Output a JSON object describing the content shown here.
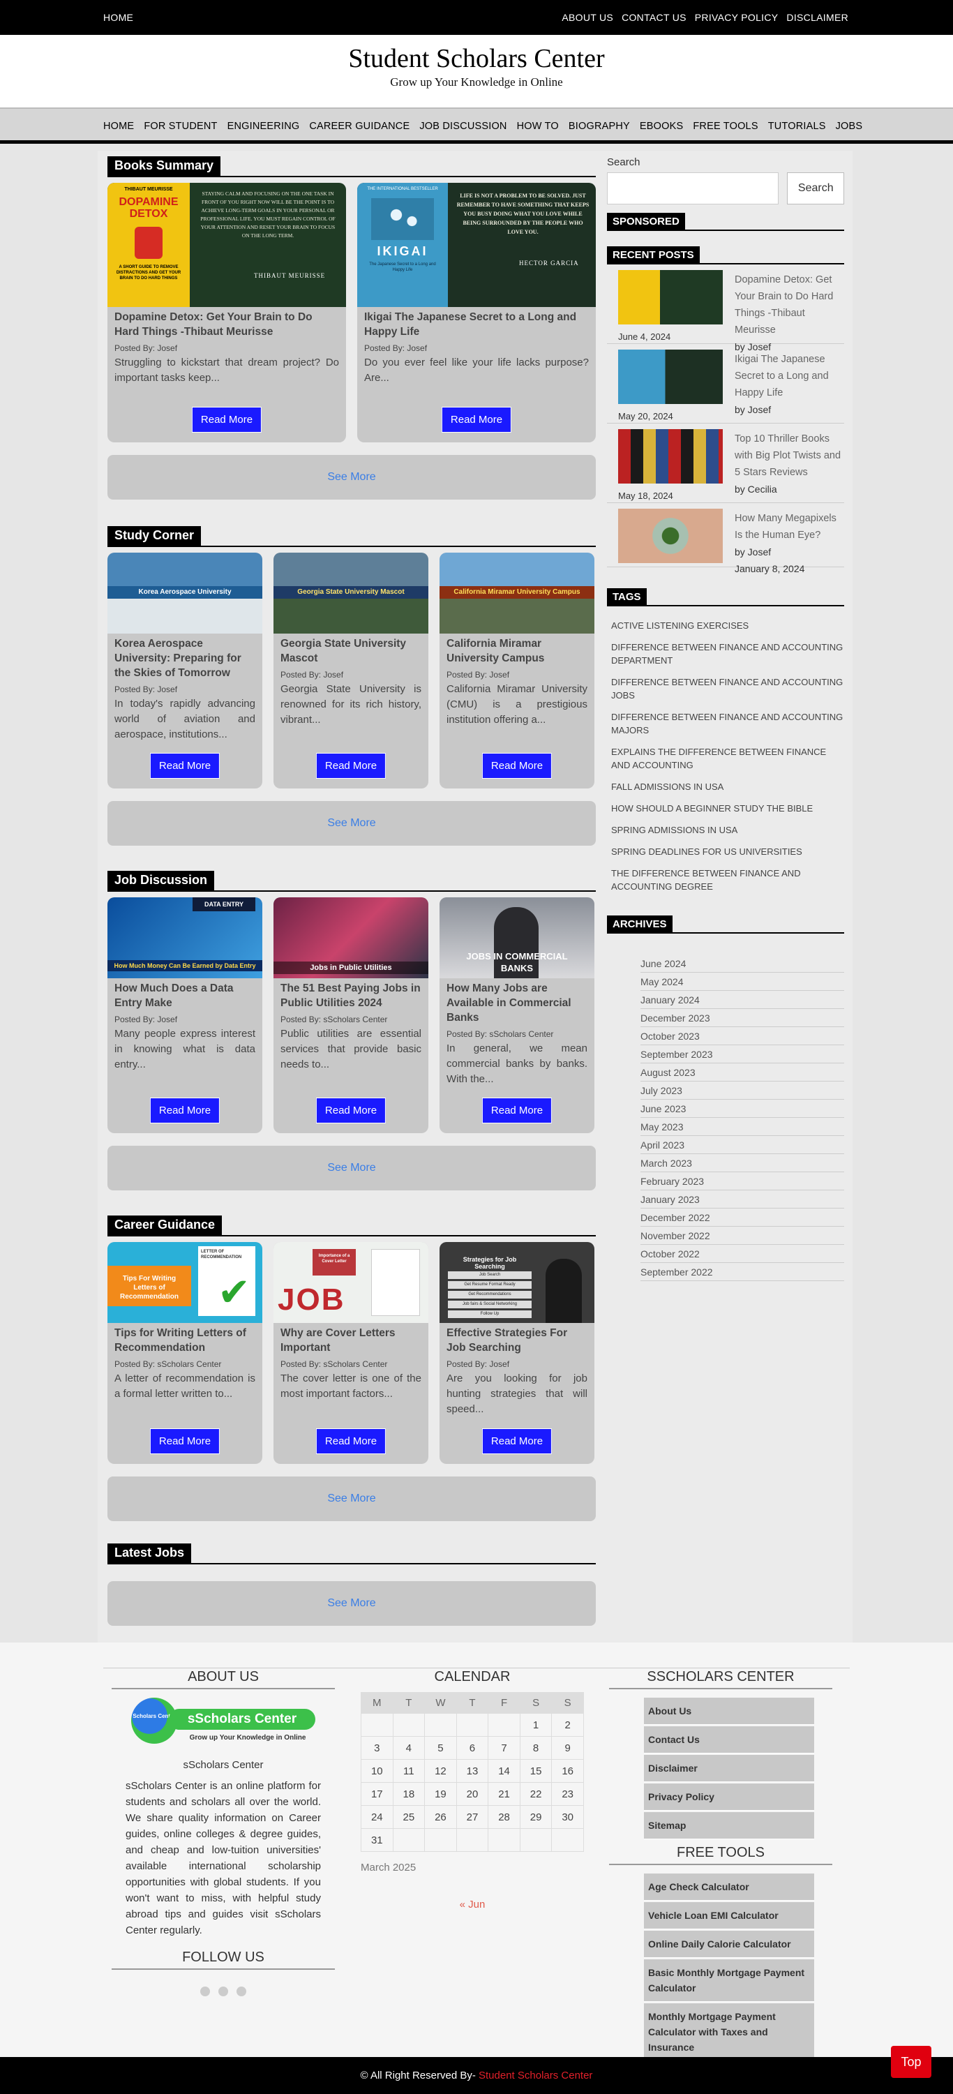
{
  "topbar": {
    "home": "HOME",
    "links": [
      "ABOUT US",
      "CONTACT US",
      "PRIVACY POLICY",
      "DISCLAIMER"
    ]
  },
  "site": {
    "title": "Student Scholars Center",
    "tagline": "Grow up Your Knowledge in Online"
  },
  "nav": [
    "HOME",
    "FOR STUDENT",
    "ENGINEERING",
    "CAREER GUIDANCE",
    "JOB DISCUSSION",
    "HOW TO",
    "BIOGRAPHY",
    "EBOOKS",
    "FREE TOOLS",
    "TUTORIALS",
    "JOBS"
  ],
  "common": {
    "read_more": "Read More",
    "see_more": "See More"
  },
  "books": {
    "heading": "Books Summary",
    "cards": [
      {
        "title": "Dopamine Detox: Get Your Brain to Do Hard Things -Thibaut Meurisse",
        "meta": "Posted By: Josef",
        "excerpt": "Struggling to kickstart that dream project? Do important tasks keep...",
        "cover_top": "THIBAUT MEURISSE",
        "cover_big": "DOPAMINE DETOX",
        "cover_sub": "A SHORT GUIDE TO REMOVE DISTRACTIONS AND GET YOUR BRAIN TO DO HARD THINGS",
        "quote": "STAYING CALM AND FOCUSING ON THE ONE TASK IN FRONT OF YOU RIGHT NOW WILL BE THE POINT IS TO ACHIEVE LONG-TERM GOALS IN YOUR PERSONAL OR PROFESSIONAL LIFE. YOU MUST REGAIN CONTROL OF YOUR ATTENTION AND RESET YOUR BRAIN TO FOCUS ON THE LONG TERM.",
        "quote_author": "THIBAUT MEURISSE"
      },
      {
        "title": "Ikigai The Japanese Secret to a Long and Happy Life",
        "meta": "Posted By: Josef",
        "excerpt": "Do you ever feel like your life lacks purpose? Are...",
        "cover_top": "THE INTERNATIONAL BESTSELLER",
        "cover_big": "IKIGAI",
        "cover_sub": "The Japanese Secret to a Long and Happy Life",
        "quote": "LIFE IS NOT A PROBLEM TO BE SOLVED. JUST REMEMBER TO HAVE SOMETHING THAT KEEPS YOU BUSY DOING WHAT YOU LOVE WHILE BEING SURROUNDED BY THE PEOPLE WHO LOVE YOU.",
        "quote_author": "HECTOR GARCIA"
      }
    ]
  },
  "study": {
    "heading": "Study Corner",
    "cards": [
      {
        "title": "Korea Aerospace University: Preparing for the Skies of Tomorrow",
        "meta": "Posted By: Josef",
        "excerpt": "In today's rapidly advancing world of aviation and aerospace, institutions...",
        "banner": "Korea Aerospace University"
      },
      {
        "title": "Georgia State University Mascot",
        "meta": "Posted By: Josef",
        "excerpt": "Georgia State University is renowned for its rich history, vibrant...",
        "banner": "Georgia State University Mascot"
      },
      {
        "title": "California Miramar University Campus",
        "meta": "Posted By: Josef",
        "excerpt": "California Miramar University (CMU) is a prestigious institution offering a...",
        "banner": "California Miramar University Campus"
      }
    ]
  },
  "jobs": {
    "heading": "Job Discussion",
    "cards": [
      {
        "title": "How Much Does a Data Entry Make",
        "meta": "Posted By: Josef",
        "excerpt": "Many people express interest in knowing what is data entry...",
        "banner": "How Much Money Can Be Earned by Data Entry",
        "badge": "DATA ENTRY"
      },
      {
        "title": "The 51 Best Paying Jobs in Public Utilities 2024",
        "meta": "Posted By: sScholars Center",
        "excerpt": "Public utilities are essential services that provide basic needs to...",
        "banner": "Jobs in Public Utilities"
      },
      {
        "title": "How Many Jobs are Available in Commercial Banks",
        "meta": "Posted By: sScholars Center",
        "excerpt": "In general, we mean commercial banks by banks. With the...",
        "banner": "JOBS IN COMMERCIAL BANKS"
      }
    ]
  },
  "career": {
    "heading": "Career Guidance",
    "cards": [
      {
        "title": "Tips for Writing Letters of Recommendation",
        "meta": "Posted By: sScholars Center",
        "excerpt": "A letter of recommendation is a formal letter written to...",
        "banner": "Tips For Writing Letters of Recommendation",
        "badge": "LETTER OF RECOMMENDATION"
      },
      {
        "title": "Why are Cover Letters Important",
        "meta": "Posted By: sScholars Center",
        "excerpt": "The cover letter is one of the most important factors...",
        "banner": "JOB",
        "badge": "Importance of a Cover Letter"
      },
      {
        "title": "Effective Strategies For Job Searching",
        "meta": "Posted By: Josef",
        "excerpt": "Are you looking for job hunting strategies that will speed...",
        "banner": "Strategies for Job Searching",
        "lines": [
          "Job Search",
          "Get Resume Format Ready",
          "Get Recommendations",
          "Job fairs & Social Networking",
          "Follow Up"
        ]
      }
    ]
  },
  "latest_jobs": {
    "heading": "Latest Jobs"
  },
  "sidebar": {
    "search_label": "Search",
    "search_button": "Search",
    "sponsored": "SPONSORED",
    "recent_title": "RECENT POSTS",
    "recent": [
      {
        "title": "Dopamine Detox: Get Your Brain to Do Hard Things -Thibaut Meurisse",
        "by": "by Josef",
        "date": "June 4, 2024"
      },
      {
        "title": "Ikigai The Japanese Secret to a Long and Happy Life",
        "by": "by Josef",
        "date": "May 20, 2024"
      },
      {
        "title": "Top 10 Thriller Books with Big Plot Twists and 5 Stars Reviews",
        "by": "by Cecilia",
        "date": "May 18, 2024"
      },
      {
        "title": "How Many Megapixels Is the Human Eye?",
        "by": "by Josef",
        "date": "January 8, 2024"
      }
    ],
    "tags_title": "TAGS",
    "tags": [
      "ACTIVE LISTENING EXERCISES",
      "DIFFERENCE BETWEEN FINANCE AND ACCOUNTING DEPARTMENT",
      "DIFFERENCE BETWEEN FINANCE AND ACCOUNTING JOBS",
      "DIFFERENCE BETWEEN FINANCE AND ACCOUNTING MAJORS",
      "EXPLAINS THE DIFFERENCE BETWEEN FINANCE AND ACCOUNTING",
      "FALL ADMISSIONS IN USA",
      "HOW SHOULD A BEGINNER STUDY THE BIBLE",
      "SPRING ADMISSIONS IN USA",
      "SPRING DEADLINES FOR US UNIVERSITIES",
      "THE DIFFERENCE BETWEEN FINANCE AND ACCOUNTING DEGREE"
    ],
    "archives_title": "ARCHIVES",
    "archives": [
      "June 2024",
      "May 2024",
      "January 2024",
      "December 2023",
      "October 2023",
      "September 2023",
      "August 2023",
      "July 2023",
      "June 2023",
      "May 2023",
      "April 2023",
      "March 2023",
      "February 2023",
      "January 2023",
      "December 2022",
      "November 2022",
      "October 2022",
      "September 2022"
    ]
  },
  "footer": {
    "about_title": "ABOUT US",
    "logo_text": "sScholars Center",
    "logo_tag": "Grow up Your Knowledge in Online",
    "logo_circle": "Scholars Center",
    "about_name": "sScholars Center",
    "about_text": "sScholars Center is an online platform for students and scholars all over the world. We share quality information on Career guides, online colleges & degree guides, and cheap and low-tuition universities' available international scholarship opportunities with global students. If you won't want to miss, with helpful study abroad tips and guides visit sScholars Center regularly.",
    "follow_title": "FOLLOW US",
    "calendar_title": "CALENDAR",
    "calendar_days": [
      "M",
      "T",
      "W",
      "T",
      "F",
      "S",
      "S"
    ],
    "calendar_rows": [
      [
        "",
        "",
        "",
        "",
        "",
        "1",
        "2"
      ],
      [
        "3",
        "4",
        "5",
        "6",
        "7",
        "8",
        "9"
      ],
      [
        "10",
        "11",
        "12",
        "13",
        "14",
        "15",
        "16"
      ],
      [
        "17",
        "18",
        "19",
        "20",
        "21",
        "22",
        "23"
      ],
      [
        "24",
        "25",
        "26",
        "27",
        "28",
        "29",
        "30"
      ],
      [
        "31",
        "",
        "",
        "",
        "",
        "",
        ""
      ]
    ],
    "calendar_caption": "March 2025",
    "calendar_prev": "« Jun",
    "center_title": "SSCHOLARS CENTER",
    "center_links": [
      "About Us",
      "Contact Us",
      "Disclaimer",
      "Privacy Policy",
      "Sitemap"
    ],
    "tools_title": "FREE TOOLS",
    "tools": [
      "Age Check Calculator",
      "Vehicle Loan EMI Calculator",
      "Online Daily Calorie Calculator",
      "Basic Monthly Mortgage Payment Calculator",
      "Monthly Mortgage Payment Calculator with Taxes and Insurance"
    ],
    "copyright": "© All Right Reserved By-",
    "copyright_site": "Student Scholars Center",
    "top_button": "Top"
  }
}
